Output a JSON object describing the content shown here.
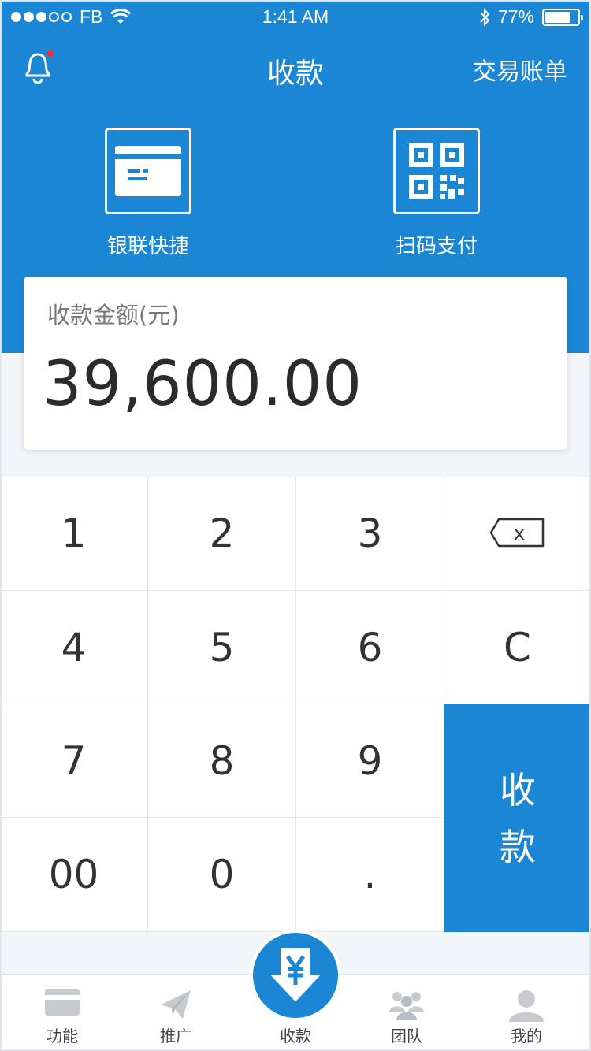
{
  "status_bar": {
    "carrier": "FB",
    "time": "1:41 AM",
    "battery_percent": "77%",
    "battery_level": 0.77
  },
  "header": {
    "title": "收款",
    "bill_label": "交易账单"
  },
  "quick_options": [
    {
      "label": "银联快捷",
      "icon": "card-icon"
    },
    {
      "label": "扫码支付",
      "icon": "qr-code-icon"
    }
  ],
  "amount_card": {
    "caption": "收款金额(元)",
    "value": "39,600.00"
  },
  "keypad": {
    "keys": [
      "1",
      "2",
      "3",
      "4",
      "5",
      "6",
      "7",
      "8",
      "9",
      "00",
      "0",
      "."
    ],
    "backspace_label": "x",
    "clear_label": "C",
    "submit_label_1": "收",
    "submit_label_2": "款"
  },
  "tab_bar": {
    "items": [
      {
        "label": "功能",
        "icon": "card-icon"
      },
      {
        "label": "推广",
        "icon": "paper-plane-icon"
      },
      {
        "label": "收款",
        "icon": "yen-download-icon"
      },
      {
        "label": "团队",
        "icon": "team-icon"
      },
      {
        "label": "我的",
        "icon": "user-icon"
      }
    ]
  },
  "colors": {
    "primary": "#1b87d4",
    "background": "#f3f6f9",
    "tab_icon": "#c7cbd0"
  }
}
